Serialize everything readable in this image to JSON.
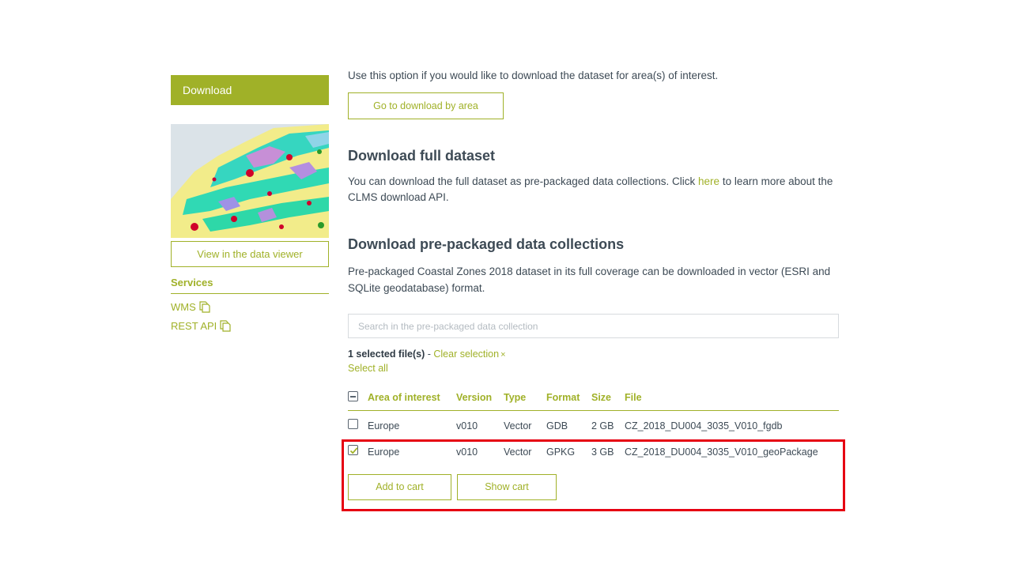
{
  "sidebar": {
    "download_label": "Download",
    "viewer_button": "View in the data viewer",
    "services_title": "Services",
    "services": [
      {
        "label": "WMS"
      },
      {
        "label": "REST API"
      }
    ]
  },
  "main": {
    "intro": "Use this option if you would like to download the dataset for area(s) of interest.",
    "area_button": "Go to download by area",
    "full_title": "Download full dataset",
    "full_text_before": "You can download the full dataset as pre-packaged data collections. Click ",
    "full_link": "here",
    "full_text_after": " to learn more about the CLMS download API.",
    "pre_title": "Download pre-packaged data collections",
    "pre_text": "Pre-packaged Coastal Zones 2018 dataset in its full coverage can be downloaded in vector (ESRI and SQLite geodatabase) format.",
    "search_placeholder": "Search in the pre-packaged data collection",
    "selected_count": "1 selected file(s)",
    "separator": " - ",
    "clear_selection": "Clear selection",
    "clear_icon": "×",
    "select_all": "Select all"
  },
  "table": {
    "headers": {
      "area": "Area of interest",
      "version": "Version",
      "type": "Type",
      "format": "Format",
      "size": "Size",
      "file": "File"
    },
    "rows": [
      {
        "checked": false,
        "area": "Europe",
        "version": "v010",
        "type": "Vector",
        "format": "GDB",
        "size": "2 GB",
        "file": "CZ_2018_DU004_3035_V010_fgdb"
      },
      {
        "checked": true,
        "area": "Europe",
        "version": "v010",
        "type": "Vector",
        "format": "GPKG",
        "size": "3 GB",
        "file": "CZ_2018_DU004_3035_V010_geoPackage"
      }
    ]
  },
  "actions": {
    "add_to_cart": "Add to cart",
    "show_cart": "Show cart"
  },
  "colors": {
    "accent": "#a0b128",
    "text": "#3d4a55",
    "highlight": "#e60012"
  }
}
